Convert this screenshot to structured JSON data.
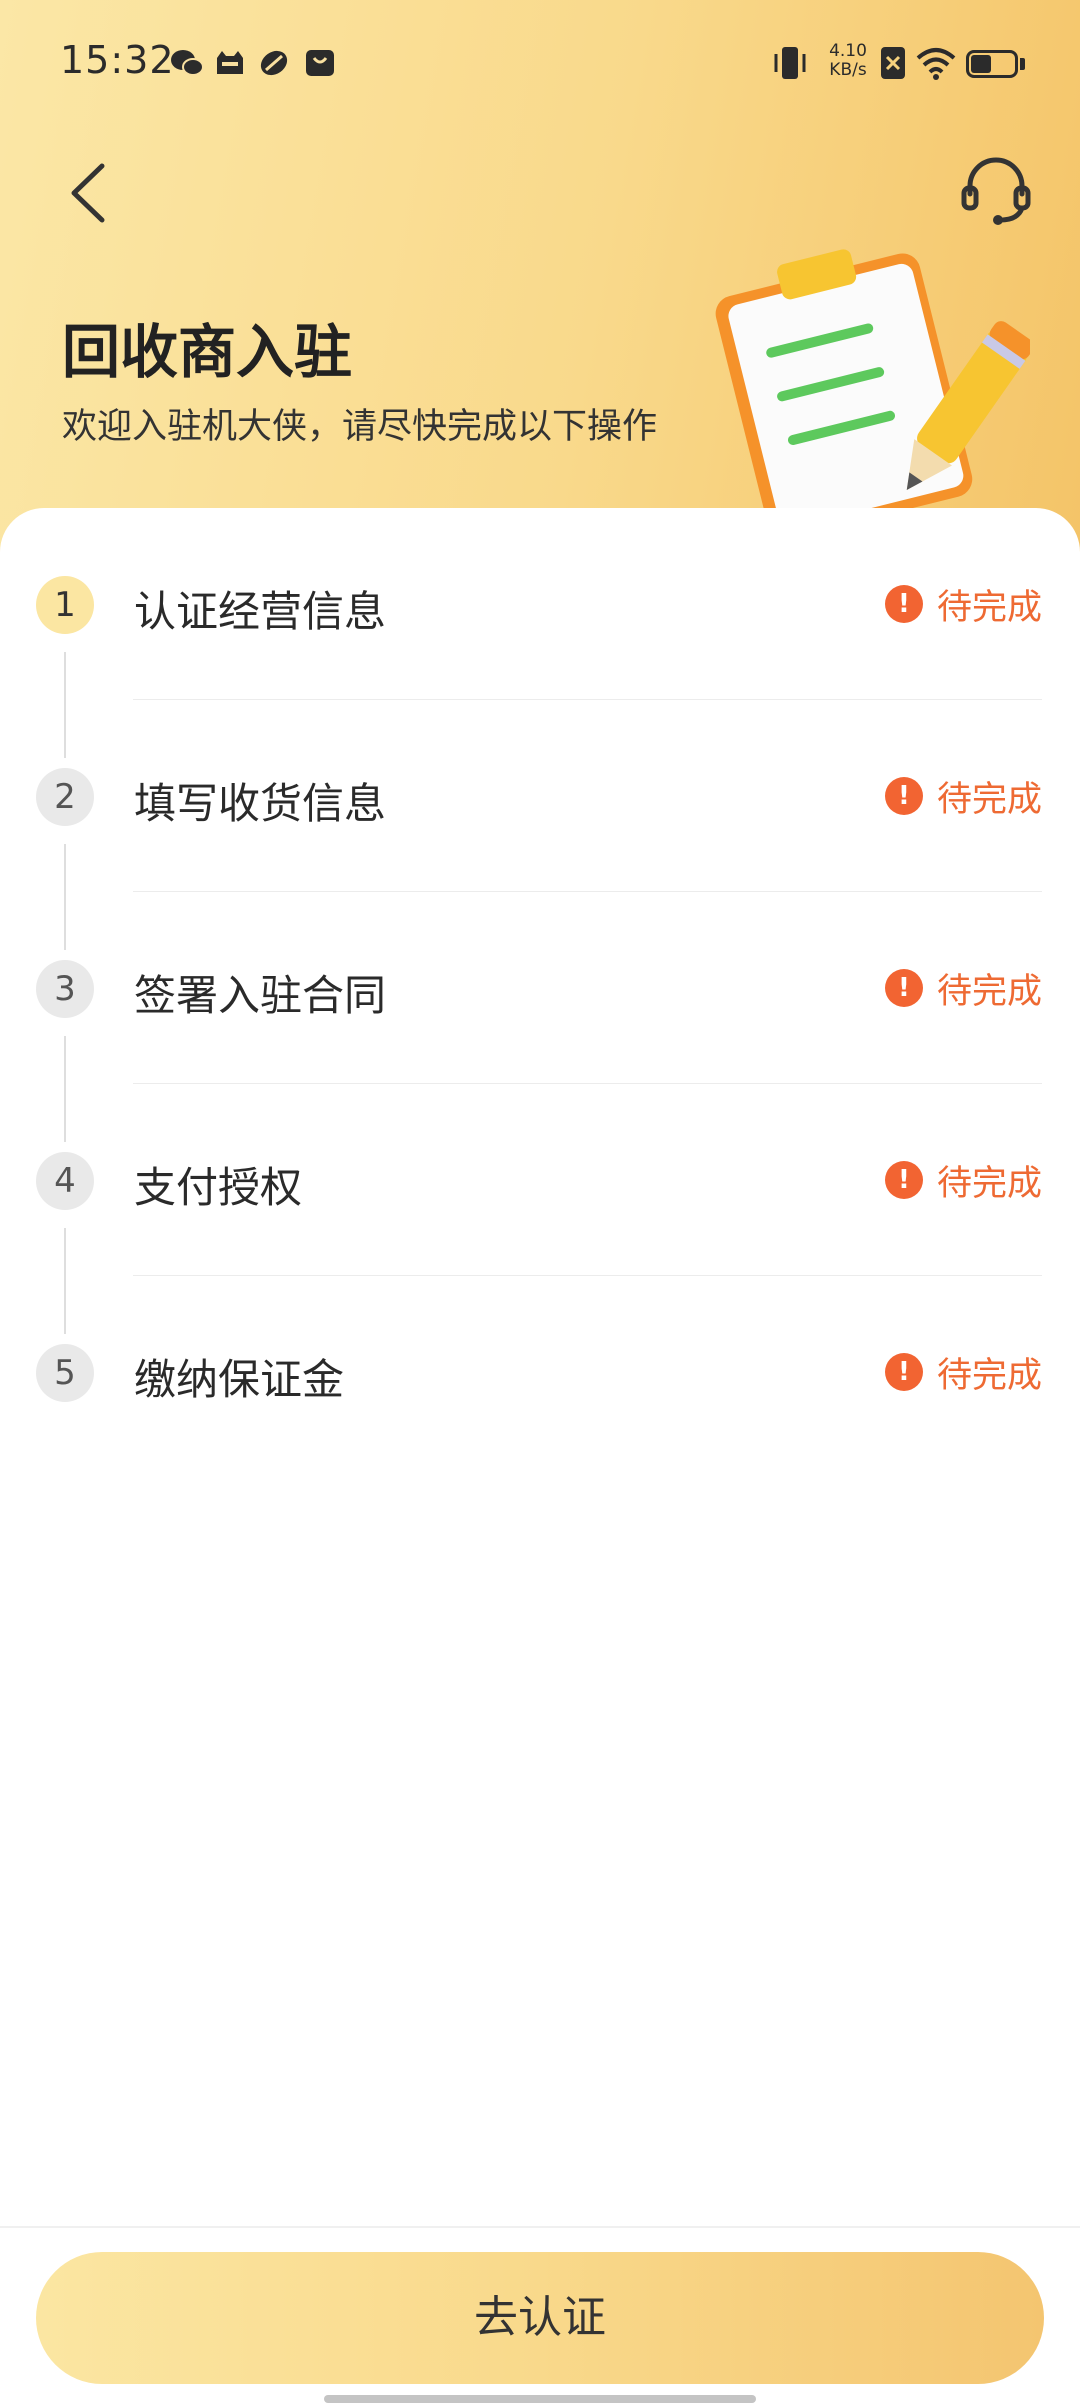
{
  "status_bar": {
    "time": "15:32",
    "net_speed_value": "4.10",
    "net_speed_unit": "KB/s",
    "left_icons": [
      "wechat-icon",
      "cat-app-icon",
      "link-app-icon",
      "shopping-bag-icon"
    ],
    "right_icons": [
      "vibrate-icon",
      "sim-off-icon",
      "wifi-icon",
      "battery-icon"
    ]
  },
  "nav": {
    "back_icon": "chevron-left-icon",
    "service_icon": "headset-icon"
  },
  "header": {
    "title": "回收商入驻",
    "subtitle": "欢迎入驻机大侠，请尽快完成以下操作"
  },
  "steps": [
    {
      "number": "1",
      "label": "认证经营信息",
      "status": "待完成",
      "active": true
    },
    {
      "number": "2",
      "label": "填写收货信息",
      "status": "待完成",
      "active": false
    },
    {
      "number": "3",
      "label": "签署入驻合同",
      "status": "待完成",
      "active": false
    },
    {
      "number": "4",
      "label": "支付授权",
      "status": "待完成",
      "active": false
    },
    {
      "number": "5",
      "label": "缴纳保证金",
      "status": "待完成",
      "active": false
    }
  ],
  "status_icon_glyph": "!",
  "primary_button": {
    "label": "去认证"
  },
  "colors": {
    "accent_yellow": "#f9d98b",
    "status_orange": "#ee6a33",
    "warn_red": "#f26432"
  }
}
